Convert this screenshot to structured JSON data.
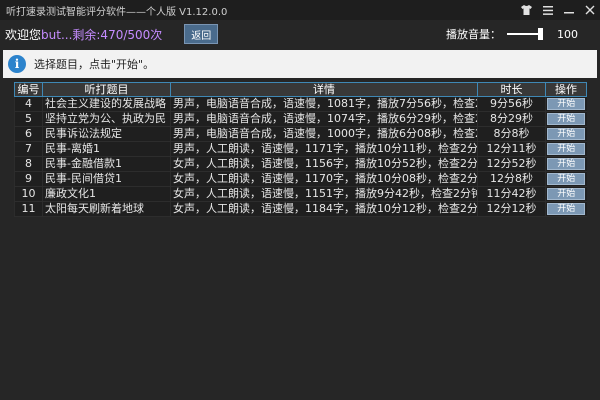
{
  "window": {
    "title": "听打速录测试智能评分软件——个人版 V1.12.0.0"
  },
  "header": {
    "welcome": "欢迎您",
    "user_status": "but...剩余:470/500次",
    "back_label": "返回",
    "volume_label": "播放音量：",
    "volume_value": "100",
    "volume_level": 1.0
  },
  "info": {
    "message": "选择题目，点击\"开始\"。"
  },
  "table": {
    "columns": [
      "编号",
      "听打题目",
      "详情",
      "时长",
      "操作"
    ],
    "rows": [
      {
        "num": "4",
        "title": "社会主义建设的发展战略",
        "detail": "男声，电脑语音合成，语速慢，1081字，播放7分56秒，检查2分钟",
        "duration": "9分56秒",
        "action": "开始"
      },
      {
        "num": "5",
        "title": "坚持立党为公、执政为民",
        "detail": "男声，电脑语音合成，语速慢，1074字，播放6分29秒，检查2分钟",
        "duration": "8分29秒",
        "action": "开始"
      },
      {
        "num": "6",
        "title": "民事诉讼法规定",
        "detail": "男声，电脑语音合成，语速慢，1000字，播放6分08秒，检查2分钟",
        "duration": "8分8秒",
        "action": "开始"
      },
      {
        "num": "7",
        "title": "民事-离婚1",
        "detail": "男声，人工朗读，语速慢，1171字，播放10分11秒，检查2分钟",
        "duration": "12分11秒",
        "action": "开始"
      },
      {
        "num": "8",
        "title": "民事-金融借款1",
        "detail": "女声，人工朗读，语速慢，1156字，播放10分52秒，检查2分钟",
        "duration": "12分52秒",
        "action": "开始"
      },
      {
        "num": "9",
        "title": "民事-民间借贷1",
        "detail": "女声，人工朗读，语速慢，1170字，播放10分08秒，检查2分钟",
        "duration": "12分8秒",
        "action": "开始"
      },
      {
        "num": "10",
        "title": "廉政文化1",
        "detail": "女声，人工朗读，语速慢，1151字，播放9分42秒，检查2分钟",
        "duration": "11分42秒",
        "action": "开始"
      },
      {
        "num": "11",
        "title": "太阳每天刷新着地球",
        "detail": "女声，人工朗读，语速慢，1184字，播放10分12秒，检查2分钟",
        "duration": "12分12秒",
        "action": "开始"
      }
    ]
  },
  "colors": {
    "accent": "#3f88b5",
    "user_text": "#c58cff",
    "button": "#7c98b4"
  },
  "icons": {
    "skin": "shirt-icon",
    "menu": "menu-icon",
    "minimize": "minimize-icon",
    "close": "close-icon",
    "info": "info-icon"
  }
}
